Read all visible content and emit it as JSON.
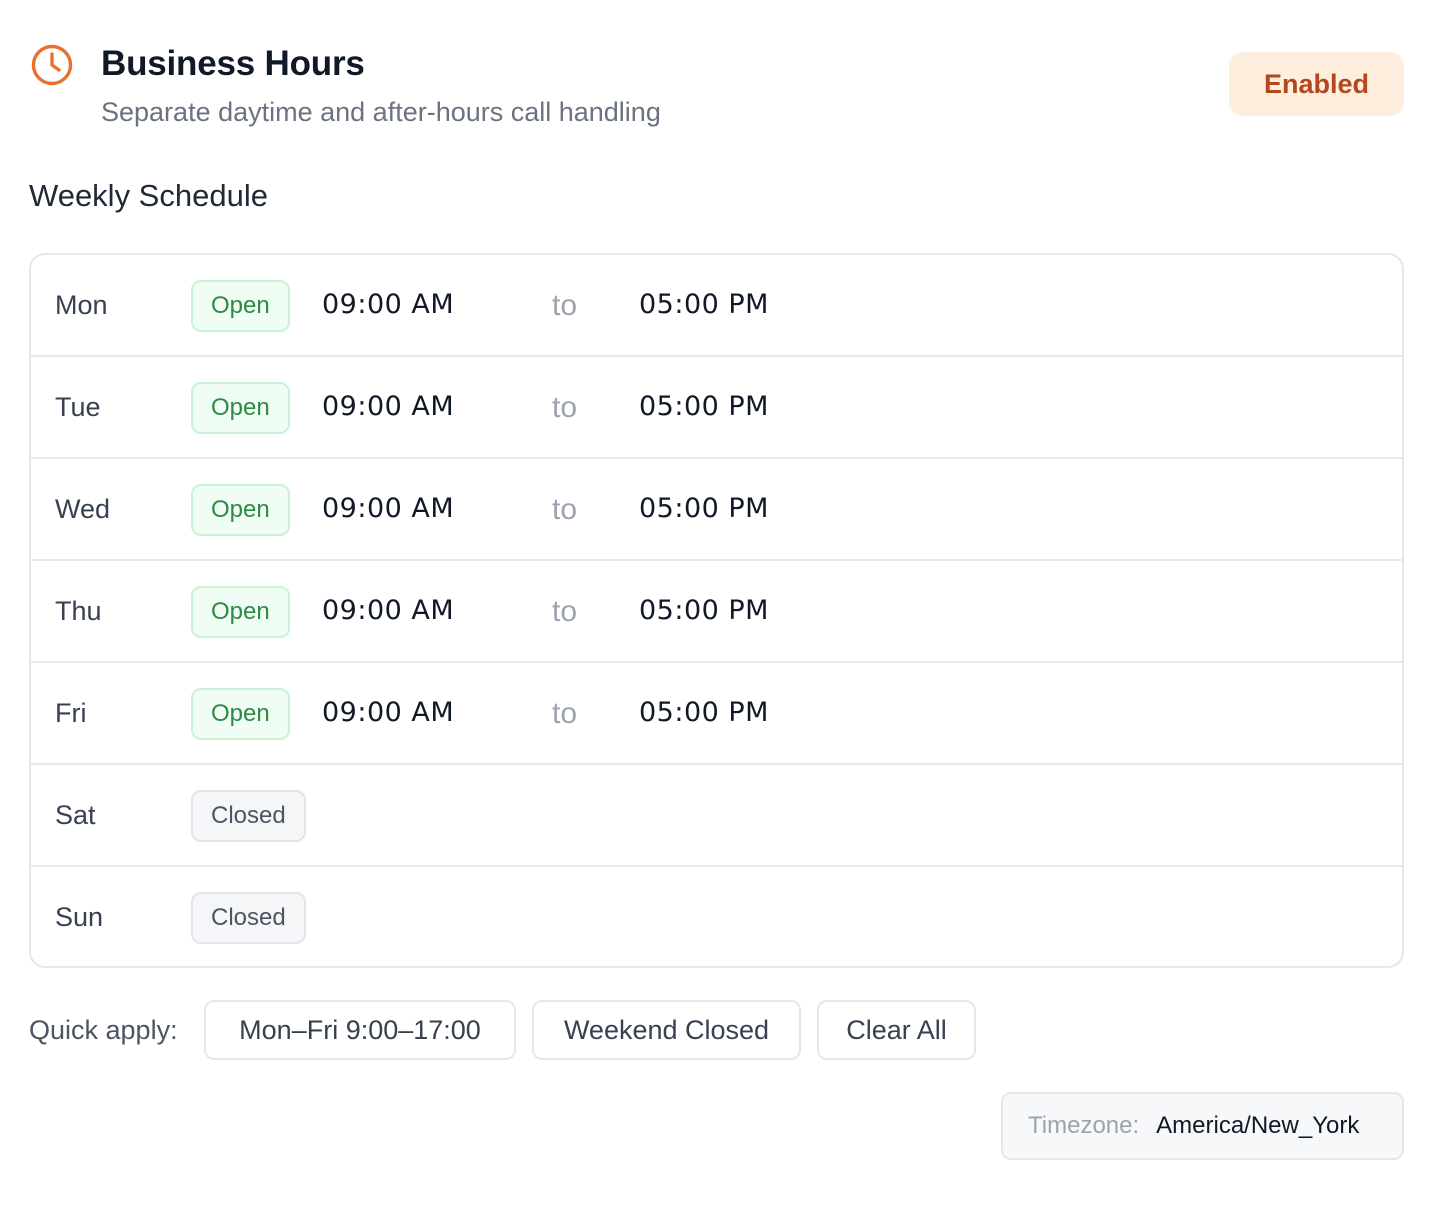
{
  "header": {
    "title": "Business Hours",
    "subtitle": "Separate daytime and after-hours call handling",
    "status_badge": "Enabled",
    "icon": "clock-icon",
    "accent_color": "#e8712f"
  },
  "schedule": {
    "heading": "Weekly Schedule",
    "separator": "to",
    "days": [
      {
        "day": "Mon",
        "status": "Open",
        "start": "09:00  AM",
        "end": "05:00  PM"
      },
      {
        "day": "Tue",
        "status": "Open",
        "start": "09:00  AM",
        "end": "05:00  PM"
      },
      {
        "day": "Wed",
        "status": "Open",
        "start": "09:00  AM",
        "end": "05:00  PM"
      },
      {
        "day": "Thu",
        "status": "Open",
        "start": "09:00  AM",
        "end": "05:00  PM"
      },
      {
        "day": "Fri",
        "status": "Open",
        "start": "09:00  AM",
        "end": "05:00  PM"
      },
      {
        "day": "Sat",
        "status": "Closed"
      },
      {
        "day": "Sun",
        "status": "Closed"
      }
    ]
  },
  "quick_apply": {
    "label": "Quick apply:",
    "buttons": [
      "Mon–Fri 9:00–17:00",
      "Weekend Closed",
      "Clear All"
    ]
  },
  "timezone": {
    "label": "Timezone:",
    "value": "America/New_York"
  }
}
